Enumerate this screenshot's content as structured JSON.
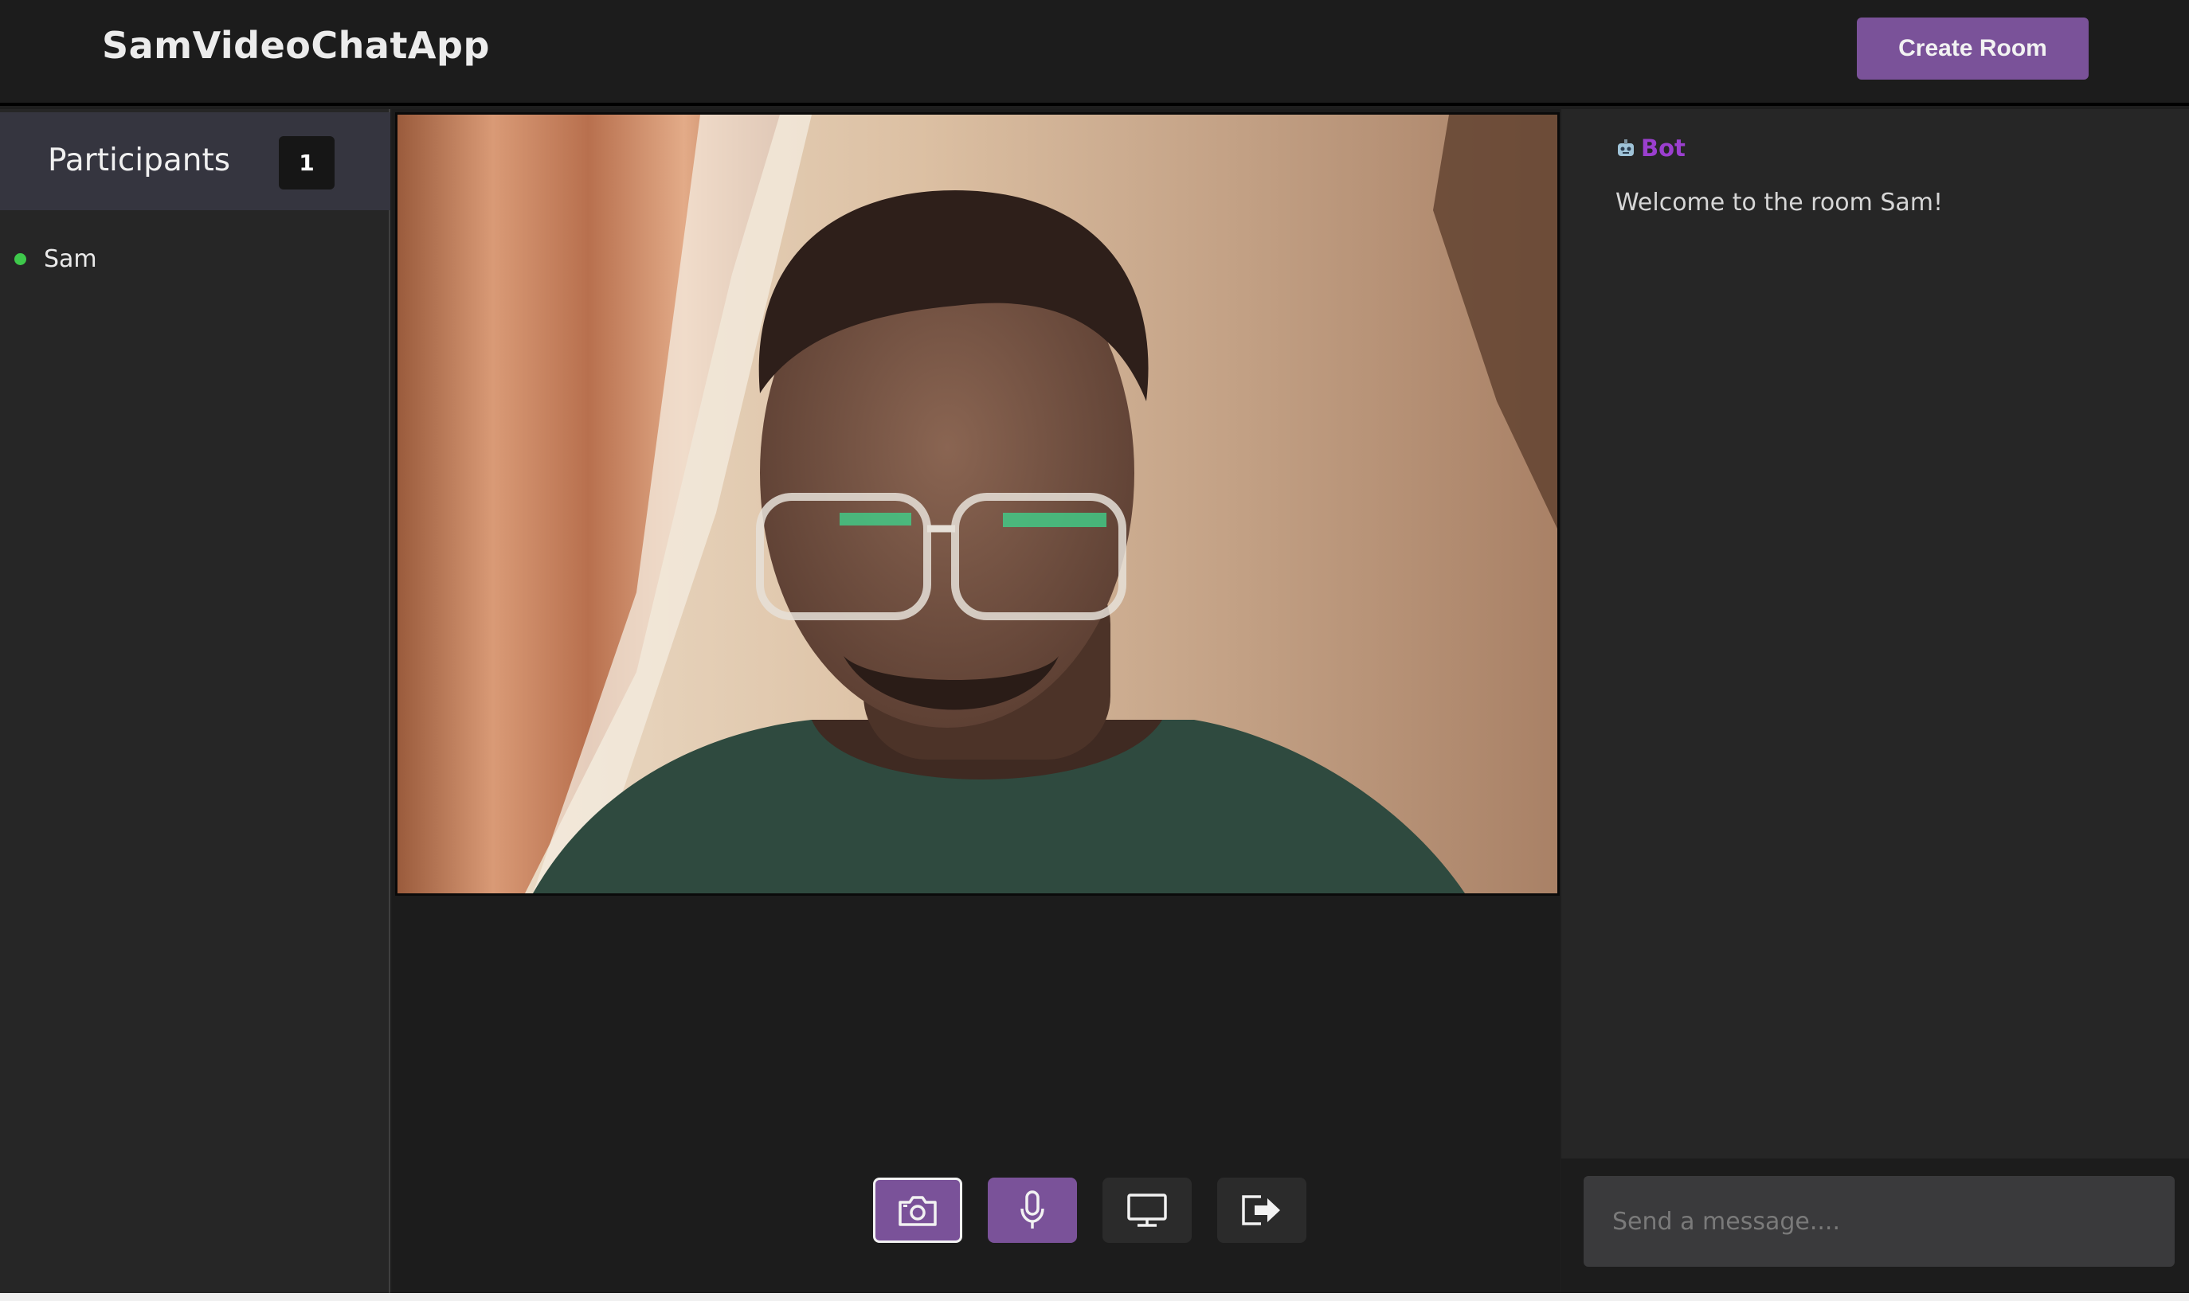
{
  "app": {
    "title": "SamVideoChatApp"
  },
  "header": {
    "create_room_label": "Create Room"
  },
  "participants": {
    "title": "Participants",
    "count": "1",
    "list": [
      {
        "name": "Sam",
        "status_color": "#3ec84b"
      }
    ]
  },
  "video": {
    "feed": "local-camera-feed"
  },
  "controls": [
    {
      "icon": "camera-icon",
      "active": true
    },
    {
      "icon": "microphone-icon",
      "active": false
    },
    {
      "icon": "screen-share-icon",
      "active": false
    },
    {
      "icon": "leave-icon",
      "active": false
    }
  ],
  "chat": {
    "messages": [
      {
        "sender": "Bot",
        "text": "Welcome to the room Sam!"
      }
    ],
    "input_placeholder": "Send a message...."
  },
  "colors": {
    "accent": "#7a5299",
    "bot_name": "#9b3fcf",
    "online": "#3ec84b"
  }
}
